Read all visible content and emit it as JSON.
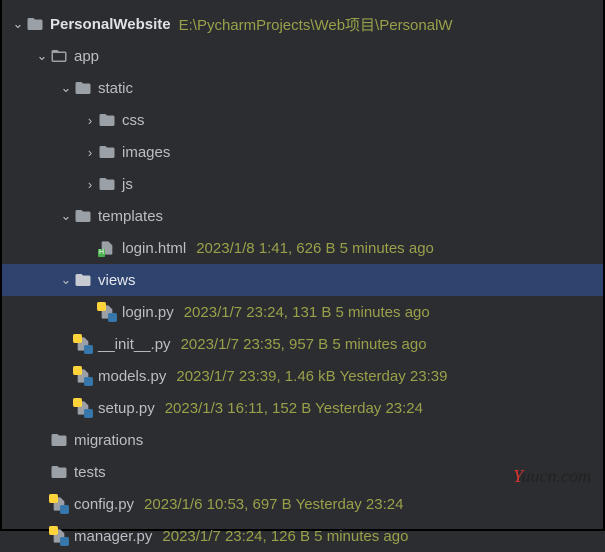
{
  "root": {
    "name": "PersonalWebsite",
    "path": "E:\\PycharmProjects\\Web项目\\PersonalW"
  },
  "tree": {
    "app": "app",
    "static": "static",
    "css": "css",
    "images": "images",
    "js": "js",
    "templates": "templates",
    "login_html": {
      "name": "login.html",
      "meta": "2023/1/8 1:41, 626 B 5 minutes ago"
    },
    "views": "views",
    "login_py": {
      "name": "login.py",
      "meta": "2023/1/7 23:24, 131 B 5 minutes ago"
    },
    "init_py": {
      "name": "__init__.py",
      "meta": "2023/1/7 23:35, 957 B 5 minutes ago"
    },
    "models_py": {
      "name": "models.py",
      "meta": "2023/1/7 23:39, 1.46 kB Yesterday 23:39"
    },
    "setup_py": {
      "name": "setup.py",
      "meta": "2023/1/3 16:11, 152 B Yesterday 23:24"
    },
    "migrations": "migrations",
    "tests": "tests",
    "config_py": {
      "name": "config.py",
      "meta": "2023/1/6 10:53, 697 B Yesterday 23:24"
    },
    "manager_py": {
      "name": "manager.py",
      "meta": "2023/1/7 23:24, 126 B 5 minutes ago"
    }
  },
  "watermark": "Yuucn.com"
}
